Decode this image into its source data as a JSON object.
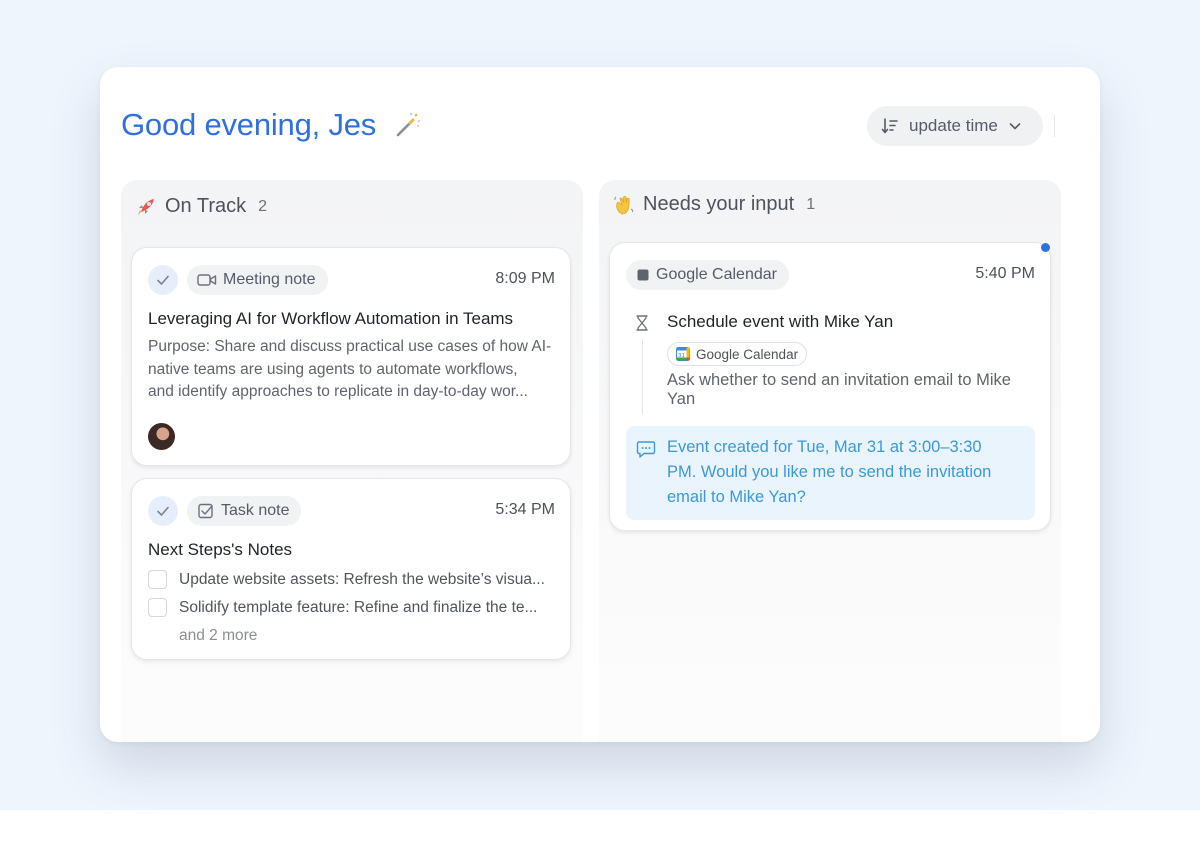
{
  "header": {
    "greeting": "Good evening, Jes",
    "sort_label": "update time"
  },
  "columns": [
    {
      "title": "On Track",
      "count": "2",
      "emoji": "rocket-icon",
      "cards": [
        {
          "type_label": "Meeting note",
          "type_icon": "video-camera-icon",
          "time": "8:09 PM",
          "title": "Leveraging AI for Workflow Automation in Teams",
          "body_lines": [
            "Purpose: Share and discuss practical use cases of how AI-",
            "native teams are using agents to automate workflows,",
            "and identify approaches to replicate in day-to-day wor..."
          ]
        },
        {
          "type_label": "Task note",
          "type_icon": "task-checkbox-icon",
          "time": "5:34 PM",
          "title": "Next Steps's Notes",
          "todos": [
            "Update website assets: Refresh the website’s visua...",
            "Solidify template feature: Refine and finalize the te..."
          ],
          "more": "and 2 more"
        }
      ]
    },
    {
      "title": "Needs your input",
      "count": "1",
      "emoji": "waving-hand-icon",
      "cards": [
        {
          "source_label": "Google Calendar",
          "time": "5:40 PM",
          "title": "Schedule event with Mike Yan",
          "tool_label": "Google Calendar",
          "body_lines": [
            "Ask whether to send an invitation email to Mike",
            "Yan"
          ],
          "message_lines": [
            "Event created for Tue, Mar 31 at 3:00–3:30",
            "PM. Would you like me to send the invitation",
            "email to Mike Yan?"
          ]
        }
      ]
    }
  ],
  "colors": {
    "accent": "#2f6fe0",
    "message_text": "#3a9ad9",
    "message_bg": "#eaf4fd"
  }
}
